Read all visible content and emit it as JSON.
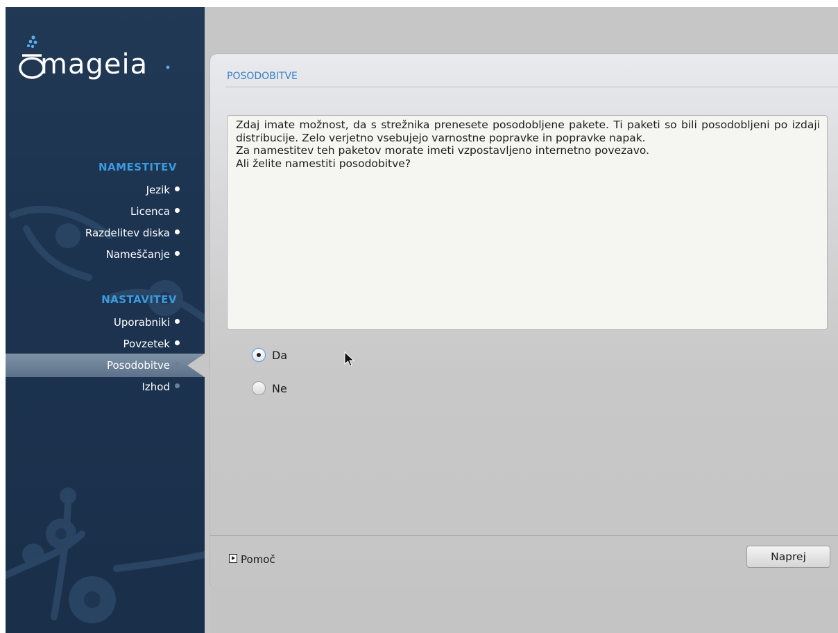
{
  "sidebar": {
    "logo_text": "mageia",
    "sections": [
      {
        "title": "NAMESTITEV",
        "items": [
          {
            "label": "Jezik"
          },
          {
            "label": "Licenca"
          },
          {
            "label": "Razdelitev diska"
          },
          {
            "label": "Nameščanje"
          }
        ]
      },
      {
        "title": "NASTAVITEV",
        "items": [
          {
            "label": "Uporabniki"
          },
          {
            "label": "Povzetek"
          },
          {
            "label": "Posodobitve",
            "active": true
          },
          {
            "label": "Izhod"
          }
        ]
      }
    ]
  },
  "panel": {
    "title": "POSODOBITVE",
    "description": {
      "paragraph1": "Zdaj imate možnost, da s strežnika prenesete posodobljene pakete. Ti paketi so bili posodobljeni po izdaji distribucije. Zelo verjetno vsebujejo varnostne popravke in popravke napak.",
      "line2": "Za namestitev teh paketov morate imeti vzpostavljeno internetno povezavo.",
      "line3": "Ali želite namestiti posodobitve?"
    },
    "options": [
      {
        "label": "Da",
        "selected": true
      },
      {
        "label": "Ne",
        "selected": false
      }
    ],
    "help_label": "Pomoč",
    "next_label": "Naprej"
  },
  "colors": {
    "sidebar_bg": "#1c3350",
    "section_title": "#3b9ae0",
    "panel_title": "#3a7fc8"
  }
}
